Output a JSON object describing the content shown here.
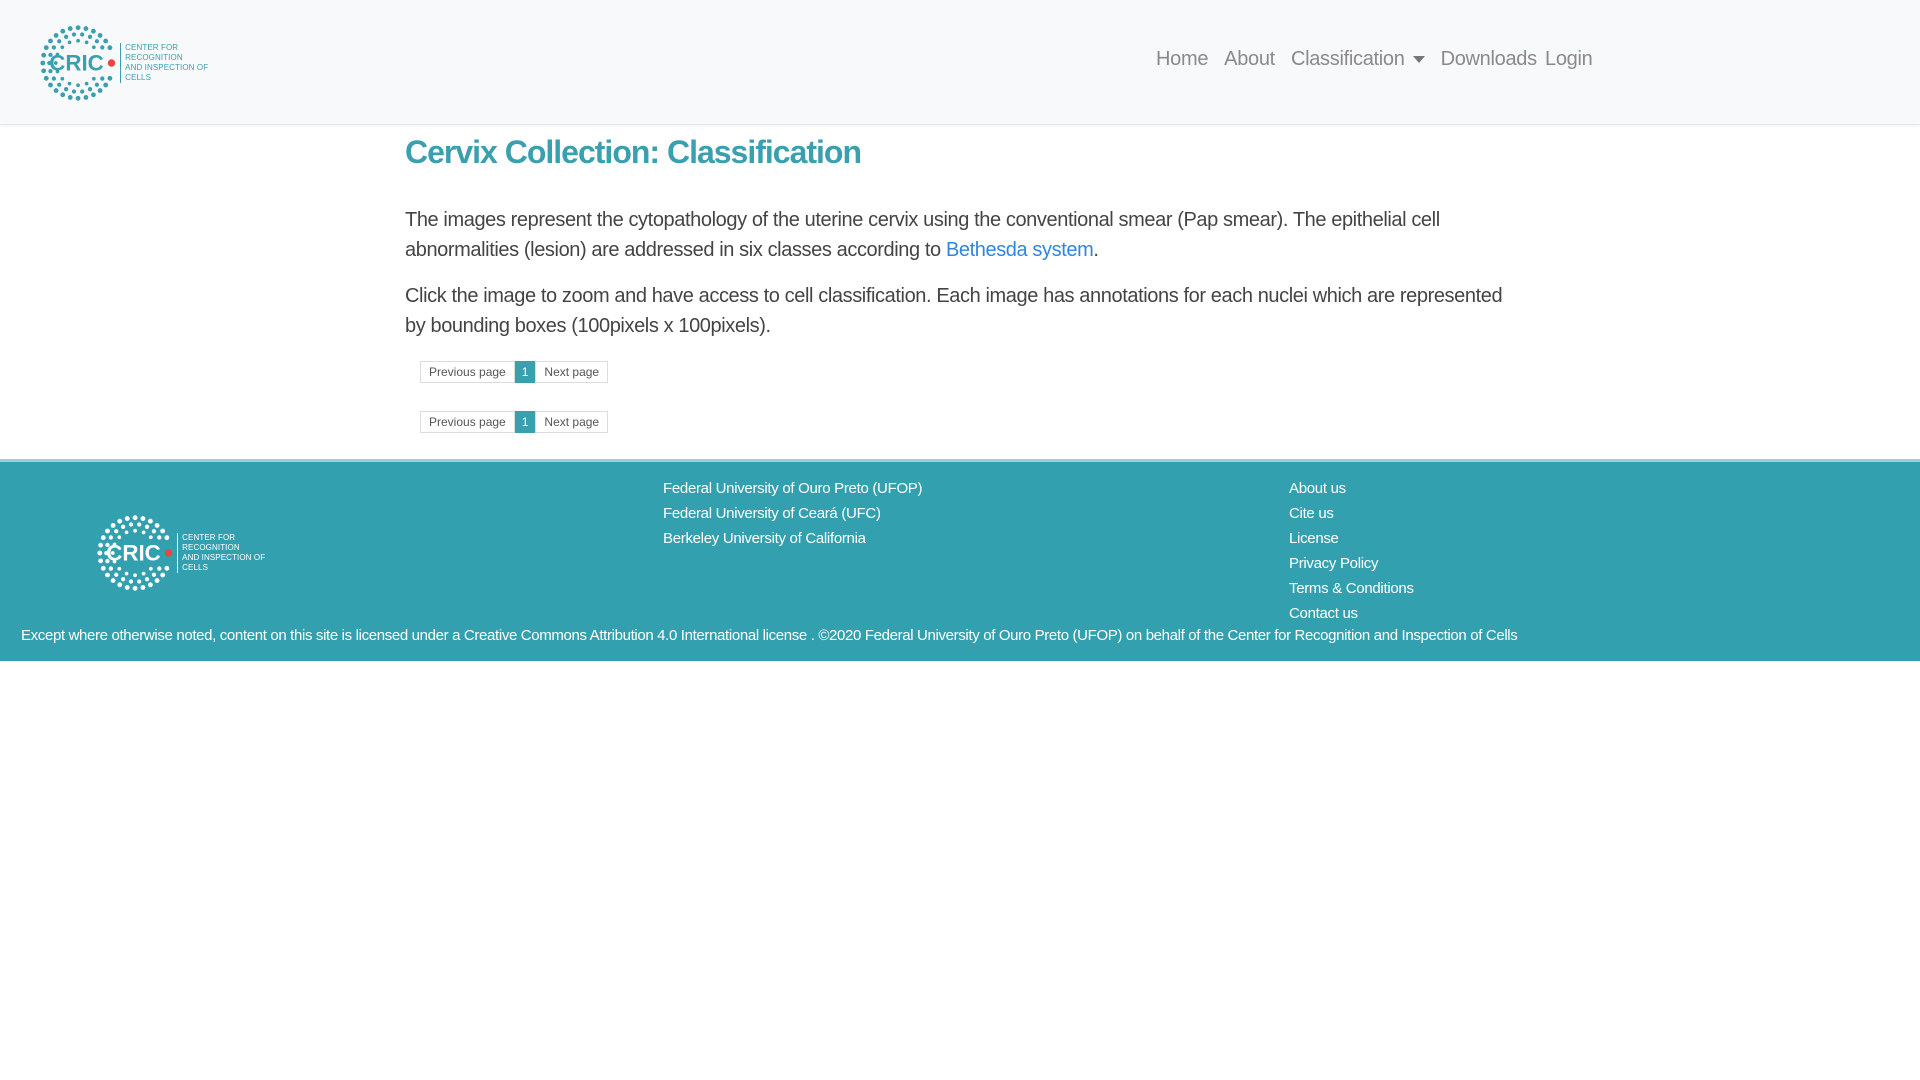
{
  "header": {
    "logo": {
      "text": "CRIC",
      "subtitle_line1": "CENTER FOR RECOGNITION",
      "subtitle_line2": "AND INSPECTION OF CELLS"
    },
    "nav": [
      {
        "label": "Home"
      },
      {
        "label": "About"
      },
      {
        "label": "Classification",
        "dropdown": true
      },
      {
        "label": "Downloads"
      }
    ],
    "login_label": "Login"
  },
  "main": {
    "title": "Cervix Collection: Classification",
    "paragraph1_prefix": "The images represent the cytopathology of the uterine cervix using the conventional smear (Pap smear). The epithelial cell abnormalities (lesion) are addressed in six classes according to ",
    "paragraph1_link": "Bethesda system",
    "paragraph1_suffix": ".",
    "paragraph2": "Click the image to zoom and have access to cell classification. Each image has annotations for each nuclei which are represented by bounding boxes (100pixels x 100pixels).",
    "pagination": {
      "previous_label": "Previous page",
      "current_page": "1",
      "next_label": "Next page"
    }
  },
  "footer": {
    "logo": {
      "text": "CRIC",
      "subtitle_line1": "CENTER FOR RECOGNITION",
      "subtitle_line2": "AND INSPECTION OF CELLS"
    },
    "universities": [
      "Federal University of Ouro Preto (UFOP)",
      "Federal University of Ceará (UFC)",
      "Berkeley University of California"
    ],
    "links": [
      "About us",
      "Cite us",
      "License",
      "Privacy Policy",
      "Terms & Conditions",
      "Contact us"
    ],
    "license_text": "Except where otherwise noted, content on this site is licensed under a Creative Commons Attribution 4.0 International license . ©2020 Federal University of Ouro Preto (UFOP) on behalf of the Center for Recognition and Inspection of Cells"
  },
  "colors": {
    "brand": "#3a9faf",
    "footer_bg": "#33a0b0",
    "link": "#2e86de",
    "logo_dot": "#e84545"
  }
}
